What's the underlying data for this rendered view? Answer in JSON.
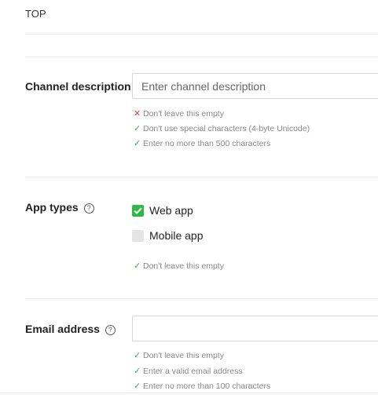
{
  "header": {
    "top_label": "TOP"
  },
  "channel_description": {
    "label": "Channel description",
    "placeholder": "Enter channel description",
    "value": "",
    "rules": [
      {
        "status": "error",
        "text": "Don't leave this empty"
      },
      {
        "status": "ok",
        "text": "Don't use special characters (4-byte Unicode)"
      },
      {
        "status": "ok",
        "text": "Enter no more than 500 characters"
      }
    ]
  },
  "app_types": {
    "label": "App types",
    "options": [
      {
        "label": "Web app",
        "checked": true
      },
      {
        "label": "Mobile app",
        "checked": false
      }
    ],
    "rules": [
      {
        "status": "ok",
        "text": "Don't leave this empty"
      }
    ]
  },
  "email_address": {
    "label": "Email address",
    "placeholder": "",
    "value": "",
    "rules": [
      {
        "status": "ok",
        "text": "Don't leave this empty"
      },
      {
        "status": "ok",
        "text": "Enter a valid email address"
      },
      {
        "status": "ok",
        "text": "Enter no more than 100 characters"
      }
    ]
  },
  "icons": {
    "ok_mark": "checkmark-icon",
    "error_mark": "cross-icon",
    "help": "question-circle-icon"
  },
  "colors": {
    "ok": "#2eb84b",
    "error": "#e5483a",
    "rule_text": "#888888",
    "divider": "#eaeaea"
  }
}
